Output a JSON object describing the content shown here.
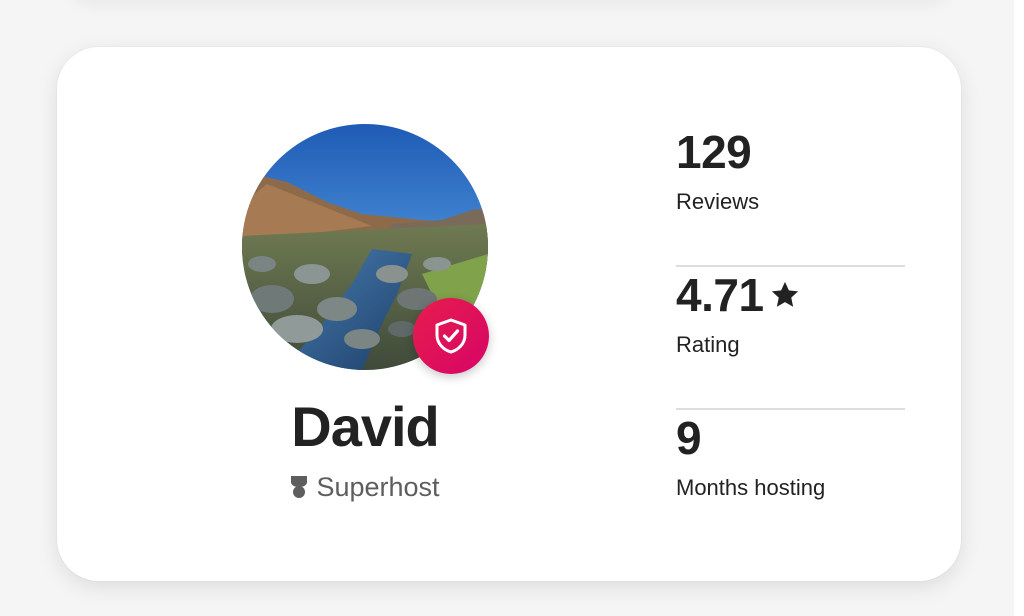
{
  "host": {
    "name": "David",
    "badge_label": "Superhost",
    "verified_icon": "shield-check-icon",
    "badge_icon": "superhost-ribbon-icon",
    "avatar_alt": "Rocky mountain stream under a blue sky"
  },
  "stats": [
    {
      "value": "129",
      "label": "Reviews"
    },
    {
      "value": "4.71",
      "label": "Rating",
      "icon": "star-icon"
    },
    {
      "value": "9",
      "label": "Months hosting"
    }
  ],
  "colors": {
    "accent": "#e61e4d",
    "text_primary": "#222222",
    "text_secondary": "#5e5e5e",
    "divider": "#dddddd",
    "card_background": "#ffffff",
    "page_background": "#f5f5f5"
  }
}
